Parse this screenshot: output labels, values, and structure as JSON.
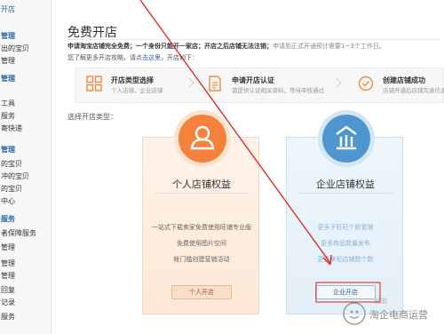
{
  "sidebar": {
    "items": [
      {
        "label": "开店",
        "kind": "accent"
      },
      {
        "label": "管理",
        "kind": "section"
      },
      {
        "label": "出的宝贝",
        "kind": "item"
      },
      {
        "label": "管理",
        "kind": "item"
      },
      {
        "label": "管理",
        "kind": "section"
      },
      {
        "label": "工具",
        "kind": "item"
      },
      {
        "label": "服务",
        "kind": "item"
      },
      {
        "label": "寄快递",
        "kind": "item"
      },
      {
        "label": "管理",
        "kind": "section"
      },
      {
        "label": "的宝贝",
        "kind": "item"
      },
      {
        "label": "冲的宝贝",
        "kind": "item"
      },
      {
        "label": "的宝贝",
        "kind": "item"
      },
      {
        "label": "中心",
        "kind": "item"
      },
      {
        "label": "服务",
        "kind": "section"
      },
      {
        "label": "者保障服务",
        "kind": "item"
      },
      {
        "label": "管理",
        "kind": "item"
      },
      {
        "label": "管理",
        "kind": "item"
      },
      {
        "label": "管理",
        "kind": "item"
      },
      {
        "label": "回复",
        "kind": "item"
      },
      {
        "label": "记录",
        "kind": "item"
      },
      {
        "label": "服务",
        "kind": "item"
      }
    ]
  },
  "header": {
    "title": "免费开店",
    "desc_bold": "申请淘宝店铺完全免费；一个身份只能开一家店；开店之后店铺无法注销；",
    "desc_gray": "申请到正式开通预计需要1~3个工作日。",
    "desc2_prefix": "您了解更多开店攻略，请",
    "desc2_link": "点击这里",
    "desc2_suffix": "，开店如下："
  },
  "steps": [
    {
      "title": "开店类型选择",
      "sub": "个人店铺，企业店铺",
      "icon": "grid-icon"
    },
    {
      "title": "申请开店认证",
      "sub": "需提供认证相关资料，等待审核通过",
      "icon": "document-icon"
    },
    {
      "title": "创建店铺成功",
      "sub": "店铺开通后店铺完善信息",
      "icon": "check-circle-icon"
    }
  ],
  "choose_label": "选择开店类型：",
  "cards": {
    "personal": {
      "title": "个人店铺权益",
      "icon": "person-icon",
      "features": [
        "一站式下载卖家免费使用旺铺专业版",
        "免费使用图片空间",
        "帐门槛创建营销活动"
      ],
      "button": "个人开店"
    },
    "company": {
      "title": "企业店铺权益",
      "icon": "enterprise-icon",
      "features": [
        "更多子旺旺个股管理",
        "更多商品数量发布",
        "更多掌柜店铺数个数"
      ],
      "button": "企业开店"
    }
  },
  "watermark": {
    "text": "淘企电商运营",
    "top_text": "经验"
  },
  "colors": {
    "accent_blue": "#2b64a8",
    "personal_orange": "#f5823c",
    "company_blue": "#4f95cf",
    "annotation_red": "#e02020"
  }
}
